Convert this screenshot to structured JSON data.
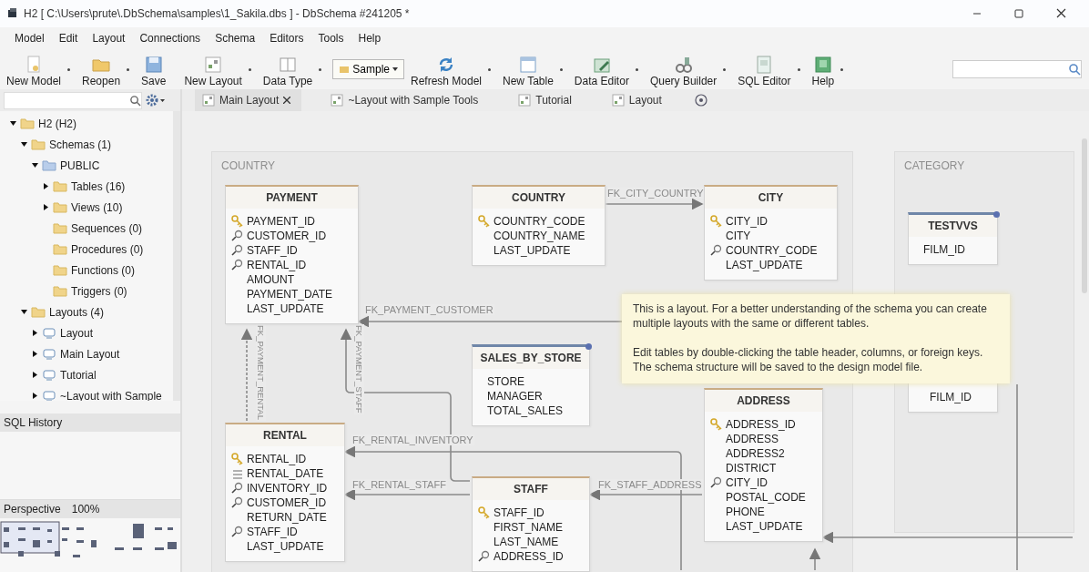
{
  "window": {
    "title": "H2 [ C:\\Users\\prute\\.DbSchema\\samples\\1_Sakila.dbs ] - DbSchema #241205 *"
  },
  "menu": [
    "Model",
    "Edit",
    "Layout",
    "Connections",
    "Schema",
    "Editors",
    "Tools",
    "Help"
  ],
  "toolbar": [
    {
      "label": "New Model",
      "kind": "button",
      "dropdown": true
    },
    {
      "label": "Reopen",
      "kind": "button",
      "dropdown": true
    },
    {
      "label": "Save",
      "kind": "button",
      "dropdown": false
    },
    {
      "label": "New Layout",
      "kind": "button",
      "dropdown": true
    },
    {
      "label": "Data Type",
      "kind": "button",
      "dropdown": true
    },
    {
      "label": "Sample",
      "kind": "combo",
      "dropdown": true
    },
    {
      "label": "Refresh Model",
      "kind": "button",
      "dropdown": true
    },
    {
      "label": "New Table",
      "kind": "button",
      "dropdown": true
    },
    {
      "label": "Data Editor",
      "kind": "button",
      "dropdown": true
    },
    {
      "label": "Query Builder",
      "kind": "button",
      "dropdown": true
    },
    {
      "label": "SQL Editor",
      "kind": "button",
      "dropdown": true
    },
    {
      "label": "Help",
      "kind": "button",
      "dropdown": true
    }
  ],
  "sidebar": {
    "tree": [
      {
        "label": "H2 (H2)",
        "kind": "folder",
        "expanded": true,
        "children": [
          {
            "label": "Schemas (1)",
            "kind": "folder",
            "expanded": true,
            "children": [
              {
                "label": "PUBLIC",
                "kind": "schema",
                "expanded": true,
                "children": [
                  {
                    "label": "Tables (16)",
                    "kind": "folder",
                    "expanded": false
                  },
                  {
                    "label": "Views (10)",
                    "kind": "folder",
                    "expanded": false
                  },
                  {
                    "label": "Sequences (0)",
                    "kind": "folder"
                  },
                  {
                    "label": "Procedures (0)",
                    "kind": "folder"
                  },
                  {
                    "label": "Functions (0)",
                    "kind": "folder"
                  },
                  {
                    "label": "Triggers (0)",
                    "kind": "folder"
                  }
                ]
              }
            ]
          },
          {
            "label": "Layouts (4)",
            "kind": "folder",
            "expanded": true,
            "children": [
              {
                "label": "Layout",
                "kind": "layout",
                "expanded": false
              },
              {
                "label": "Main Layout",
                "kind": "layout",
                "expanded": false
              },
              {
                "label": "Tutorial",
                "kind": "layout",
                "expanded": false
              },
              {
                "label": "~Layout with Sample",
                "kind": "layout",
                "expanded": false
              }
            ]
          }
        ]
      }
    ],
    "sql_history": {
      "title": "SQL History"
    },
    "perspective": {
      "title": "Perspective",
      "zoom": "100%"
    }
  },
  "tabs": [
    {
      "label": "Main Layout",
      "selected": true,
      "closable": true
    },
    {
      "label": "~Layout with Sample Tools",
      "selected": false,
      "closable": false
    },
    {
      "label": "Tutorial",
      "selected": false,
      "closable": false
    },
    {
      "label": "Layout",
      "selected": false,
      "closable": false
    }
  ],
  "diagram": {
    "groups": [
      {
        "label": "COUNTRY"
      },
      {
        "label": "CATEGORY"
      }
    ],
    "tables": [
      {
        "name": "PAYMENT",
        "kind": "table",
        "columns": [
          {
            "name": "PAYMENT_ID",
            "kind": "pk"
          },
          {
            "name": "CUSTOMER_ID",
            "kind": "fk"
          },
          {
            "name": "STAFF_ID",
            "kind": "fk"
          },
          {
            "name": "RENTAL_ID",
            "kind": "fk"
          },
          {
            "name": "AMOUNT",
            "kind": "plain"
          },
          {
            "name": "PAYMENT_DATE",
            "kind": "plain"
          },
          {
            "name": "LAST_UPDATE",
            "kind": "plain"
          }
        ]
      },
      {
        "name": "COUNTRY",
        "kind": "table",
        "columns": [
          {
            "name": "COUNTRY_CODE",
            "kind": "pk"
          },
          {
            "name": "COUNTRY_NAME",
            "kind": "plain"
          },
          {
            "name": "LAST_UPDATE",
            "kind": "plain"
          }
        ]
      },
      {
        "name": "CITY",
        "kind": "table",
        "columns": [
          {
            "name": "CITY_ID",
            "kind": "pk"
          },
          {
            "name": "CITY",
            "kind": "plain"
          },
          {
            "name": "COUNTRY_CODE",
            "kind": "fk"
          },
          {
            "name": "LAST_UPDATE",
            "kind": "plain"
          }
        ]
      },
      {
        "name": "TESTVVS",
        "kind": "view",
        "columns": [
          {
            "name": "FILM_ID",
            "kind": "plain"
          }
        ]
      },
      {
        "name": "SALES_BY_STORE",
        "kind": "view",
        "columns": [
          {
            "name": "STORE",
            "kind": "plain"
          },
          {
            "name": "MANAGER",
            "kind": "plain"
          },
          {
            "name": "TOTAL_SALES",
            "kind": "plain"
          }
        ]
      },
      {
        "name": "RENTAL",
        "kind": "table",
        "columns": [
          {
            "name": "RENTAL_ID",
            "kind": "pk"
          },
          {
            "name": "RENTAL_DATE",
            "kind": "index"
          },
          {
            "name": "INVENTORY_ID",
            "kind": "fk"
          },
          {
            "name": "CUSTOMER_ID",
            "kind": "fk"
          },
          {
            "name": "RETURN_DATE",
            "kind": "plain"
          },
          {
            "name": "STAFF_ID",
            "kind": "fk"
          },
          {
            "name": "LAST_UPDATE",
            "kind": "plain"
          }
        ]
      },
      {
        "name": "STAFF",
        "kind": "table",
        "columns": [
          {
            "name": "STAFF_ID",
            "kind": "pk"
          },
          {
            "name": "FIRST_NAME",
            "kind": "plain"
          },
          {
            "name": "LAST_NAME",
            "kind": "plain"
          },
          {
            "name": "ADDRESS_ID",
            "kind": "fk"
          }
        ]
      },
      {
        "name": "ADDRESS",
        "kind": "table",
        "columns": [
          {
            "name": "ADDRESS_ID",
            "kind": "pk"
          },
          {
            "name": "ADDRESS",
            "kind": "plain"
          },
          {
            "name": "ADDRESS2",
            "kind": "plain"
          },
          {
            "name": "DISTRICT",
            "kind": "plain"
          },
          {
            "name": "CITY_ID",
            "kind": "fk"
          },
          {
            "name": "POSTAL_CODE",
            "kind": "plain"
          },
          {
            "name": "PHONE",
            "kind": "plain"
          },
          {
            "name": "LAST_UPDATE",
            "kind": "plain"
          }
        ]
      },
      {
        "kind": "table",
        "columns": [
          {
            "name": "FILM_ID",
            "kind": "plain"
          }
        ]
      }
    ],
    "relations": [
      "FK_CITY_COUNTRY",
      "FK_PAYMENT_CUSTOMER",
      "FK_PAYMENT_RENTAL",
      "FK_PAYMENT_STAFF",
      "FK_RENTAL_INVENTORY",
      "FK_RENTAL_STAFF",
      "FK_STAFF_ADDRESS"
    ],
    "note": {
      "paragraphs": [
        "This is a layout. For a better understanding of the schema you can create multiple layouts with the same or different tables.",
        "Edit tables by double-clicking the table header, columns, or foreign keys. The schema structure will be saved to the design model file."
      ]
    }
  }
}
